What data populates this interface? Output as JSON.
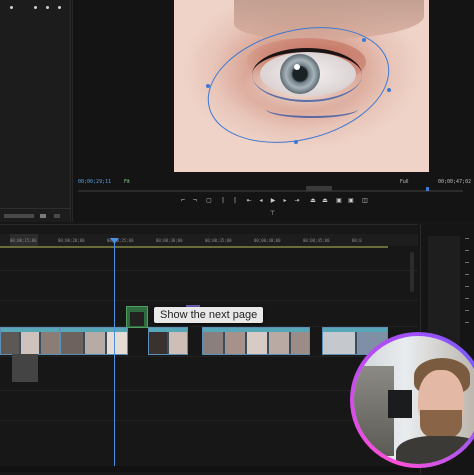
{
  "program_monitor": {
    "timecode": "00;00;29;11",
    "fit": "Fit",
    "resolution": "Full",
    "duration": "00;00;47;02"
  },
  "timeline": {
    "ruler_labels": [
      "00;00;15;00",
      "00;00;20;00",
      "00;00;25;00",
      "00;00;30;00",
      "00;00;35;00",
      "00;00;40;00",
      "00;00;45;00",
      "00;0"
    ]
  },
  "tooltip": {
    "text": "Show the next page"
  },
  "colors": {
    "accent": "#4a8fe0",
    "clip_header": "#58a7b8",
    "webcam_ring": "#b44cf5"
  },
  "icons": {
    "transport": [
      "mark-in-icon",
      "mark-out-icon",
      "go-to-in-icon",
      "step-back-icon",
      "play-icon",
      "step-forward-icon",
      "go-to-out-icon",
      "lift-icon",
      "extract-icon",
      "export-frame-icon",
      "settings-icon",
      "add-button-icon"
    ]
  }
}
